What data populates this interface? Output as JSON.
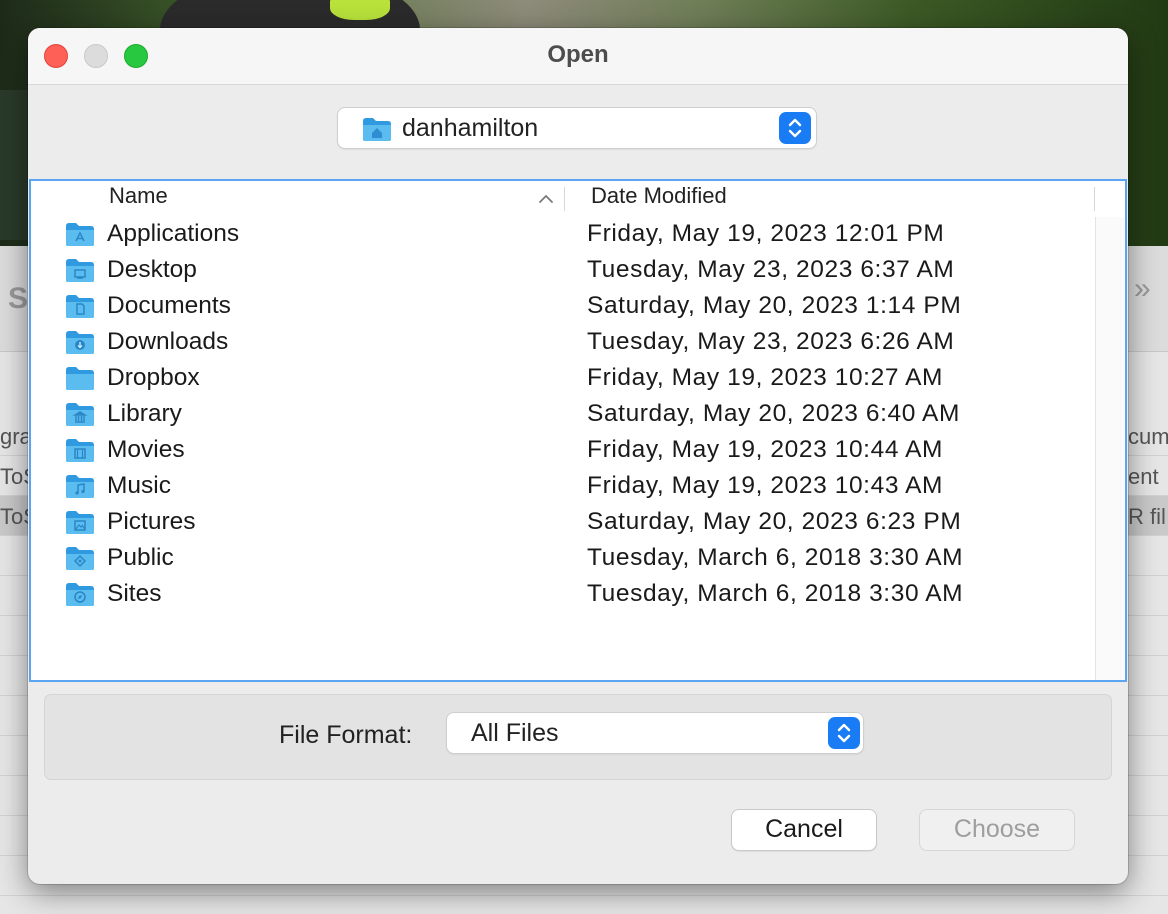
{
  "window": {
    "title": "Open"
  },
  "location": {
    "current_folder": "danhamilton",
    "icon": "home-folder-icon"
  },
  "columns": {
    "name": "Name",
    "date_modified": "Date Modified",
    "sort": "ascending"
  },
  "files": [
    {
      "name": "Applications",
      "date": "Friday, May 19, 2023 12:01 PM",
      "icon": "applications-folder-icon"
    },
    {
      "name": "Desktop",
      "date": "Tuesday, May 23, 2023 6:37 AM",
      "icon": "desktop-folder-icon"
    },
    {
      "name": "Documents",
      "date": "Saturday, May 20, 2023 1:14 PM",
      "icon": "documents-folder-icon"
    },
    {
      "name": "Downloads",
      "date": "Tuesday, May 23, 2023 6:26 AM",
      "icon": "downloads-folder-icon"
    },
    {
      "name": "Dropbox",
      "date": "Friday, May 19, 2023 10:27 AM",
      "icon": "dropbox-folder-icon"
    },
    {
      "name": "Library",
      "date": "Saturday, May 20, 2023 6:40 AM",
      "icon": "library-folder-icon"
    },
    {
      "name": "Movies",
      "date": "Friday, May 19, 2023 10:44 AM",
      "icon": "movies-folder-icon"
    },
    {
      "name": "Music",
      "date": "Friday, May 19, 2023 10:43 AM",
      "icon": "music-folder-icon"
    },
    {
      "name": "Pictures",
      "date": "Saturday, May 20, 2023 6:23 PM",
      "icon": "pictures-folder-icon"
    },
    {
      "name": "Public",
      "date": "Tuesday, March 6, 2018 3:30 AM",
      "icon": "public-folder-icon"
    },
    {
      "name": "Sites",
      "date": "Tuesday, March 6, 2018 3:30 AM",
      "icon": "sites-folder-icon"
    }
  ],
  "file_format": {
    "label": "File Format:",
    "value": "All Files"
  },
  "buttons": {
    "cancel": "Cancel",
    "choose": "Choose",
    "choose_enabled": false
  },
  "background": {
    "left_letter": "S",
    "rows": [
      {
        "left": "gra",
        "right": "cum"
      },
      {
        "left": "ToS",
        "right": "ent"
      },
      {
        "left": "ToS",
        "right": "R fil"
      }
    ]
  },
  "colors": {
    "accent": "#1a7cf5",
    "folder": "#5bbcf0",
    "close": "#fe5f57",
    "maximize": "#28c840"
  }
}
